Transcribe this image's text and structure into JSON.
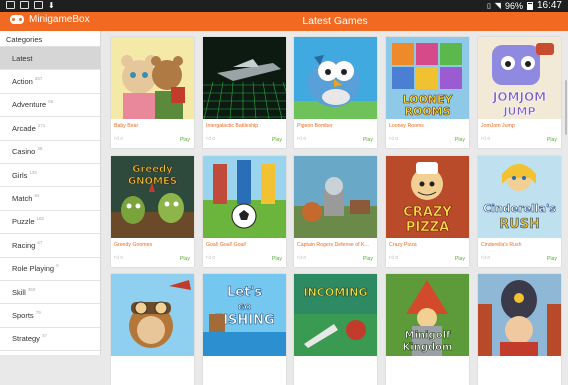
{
  "status_bar": {
    "battery": "96%",
    "time": "16:47",
    "icons": [
      "photo-icon",
      "notification-icon",
      "cast-icon",
      "download-icon",
      "vibrate-icon",
      "wifi-icon",
      "battery-icon"
    ]
  },
  "app_bar": {
    "brand": "MinigameBox",
    "title": "Latest Games",
    "accent": "#f26a21"
  },
  "sidebar": {
    "header": "Categories",
    "items": [
      {
        "label": "Latest",
        "count": "",
        "active": true
      },
      {
        "label": "Action",
        "count": "367"
      },
      {
        "label": "Adventure",
        "count": "85"
      },
      {
        "label": "Arcade",
        "count": "271"
      },
      {
        "label": "Casino",
        "count": "38"
      },
      {
        "label": "Girls",
        "count": "135"
      },
      {
        "label": "Match",
        "count": "94"
      },
      {
        "label": "Puzzle",
        "count": "182"
      },
      {
        "label": "Racing",
        "count": "57"
      },
      {
        "label": "Role Playing",
        "count": "9"
      },
      {
        "label": "Skill",
        "count": "350"
      },
      {
        "label": "Sports",
        "count": "79"
      },
      {
        "label": "Strategy",
        "count": "37"
      }
    ]
  },
  "games": [
    {
      "name": "Baby Bear",
      "rating": "0",
      "play": "Play",
      "thumb": "bears"
    },
    {
      "name": "Intergalactic Battleship",
      "rating": "0",
      "play": "Play",
      "thumb": "space"
    },
    {
      "name": "Pigeon Bomber",
      "rating": "0",
      "play": "Play",
      "thumb": "pigeon"
    },
    {
      "name": "Looney Rooms",
      "rating": "0",
      "play": "Play",
      "thumb": "looney",
      "title_text": "LOONEY ROOMS"
    },
    {
      "name": "JomJom Jump",
      "rating": "0",
      "play": "Play",
      "thumb": "jomjom",
      "title_text": "JOMJOM JUMP"
    },
    {
      "name": "Greedy Gnomes",
      "rating": "0",
      "play": "Play",
      "thumb": "gnomes",
      "title_text": "Greedy GNOMES"
    },
    {
      "name": "Goal! Goal! Goal!",
      "rating": "0",
      "play": "Play",
      "thumb": "soccer"
    },
    {
      "name": "Captain Rogers Defense of K...",
      "rating": "0",
      "play": "Play",
      "thumb": "captain"
    },
    {
      "name": "Crazy Pizza",
      "rating": "0",
      "play": "Play",
      "thumb": "pizza",
      "title_text": "CRAZY PIZZA"
    },
    {
      "name": "Cinderella's Rush",
      "rating": "0",
      "play": "Play",
      "thumb": "cinderella",
      "title_text": "Cinderella's RUSH"
    },
    {
      "name": "",
      "rating": "",
      "play": "",
      "thumb": "pilot"
    },
    {
      "name": "",
      "rating": "",
      "play": "",
      "thumb": "fishing",
      "title_text": "Let's GO FISHING"
    },
    {
      "name": "",
      "rating": "",
      "play": "",
      "thumb": "incoming",
      "title_text": "INCOMING"
    },
    {
      "name": "",
      "rating": "",
      "play": "",
      "thumb": "minigolf",
      "title_text": "Minigolf Kingdom"
    },
    {
      "name": "",
      "rating": "",
      "play": "",
      "thumb": "guard"
    }
  ]
}
